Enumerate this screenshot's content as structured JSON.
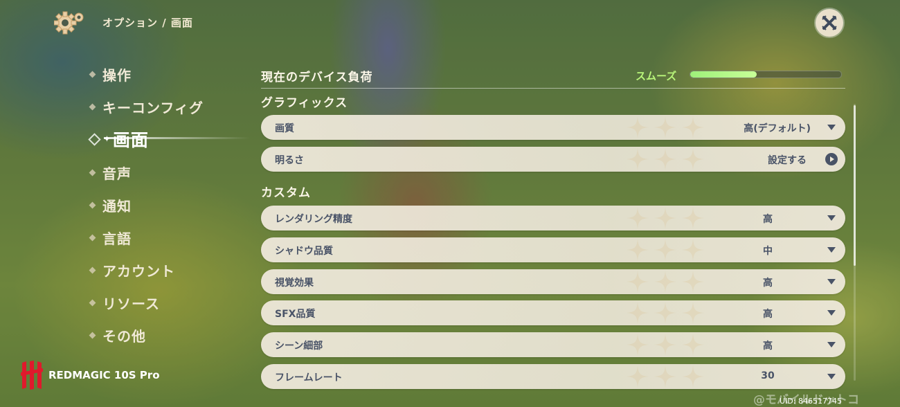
{
  "header": {
    "breadcrumb": "オプション / 画面",
    "close_icon": "close-icon"
  },
  "sidebar": {
    "items": [
      {
        "label": "操作"
      },
      {
        "label": "キーコンフィグ"
      },
      {
        "label": "画面",
        "active": true
      },
      {
        "label": "音声"
      },
      {
        "label": "通知"
      },
      {
        "label": "言語"
      },
      {
        "label": "アカウント"
      },
      {
        "label": "リソース"
      },
      {
        "label": "その他"
      }
    ]
  },
  "device_load": {
    "label": "現在のデバイス負荷",
    "status": "スムーズ",
    "level": 0.44,
    "status_color": "#b8f57a"
  },
  "sections": {
    "graphics": "グラフィックス",
    "custom": "カスタム"
  },
  "settings": {
    "quality": {
      "label": "画質",
      "value": "高(デフォルト)"
    },
    "brightness": {
      "label": "明るさ",
      "value": "設定する"
    },
    "render_precision": {
      "label": "レンダリング精度",
      "value": "高"
    },
    "shadow_quality": {
      "label": "シャドウ品質",
      "value": "中"
    },
    "visual_effects": {
      "label": "視覚効果",
      "value": "高"
    },
    "sfx_quality": {
      "label": "SFX品質",
      "value": "高"
    },
    "scene_detail": {
      "label": "シーン細部",
      "value": "高"
    },
    "frame_rate": {
      "label": "フレームレート",
      "value": "30"
    }
  },
  "footer": {
    "brand": "REDMAGIC 10S Pro",
    "watermark": "@モバイルドットコ",
    "uid": "UID: 846517745"
  }
}
